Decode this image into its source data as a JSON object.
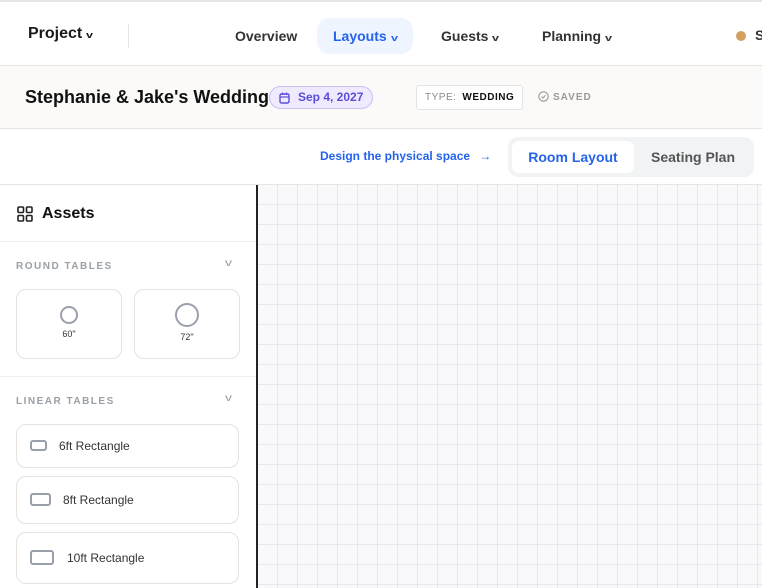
{
  "topnav": {
    "project": "Project",
    "items": [
      {
        "label": "Overview"
      },
      {
        "label": "Layouts",
        "active": true
      },
      {
        "label": "Guests"
      },
      {
        "label": "Planning"
      }
    ],
    "user_initial": "S",
    "status_color": "#d4a060"
  },
  "event": {
    "title": "Stephanie & Jake's Wedding",
    "date": "Sep 4, 2027",
    "type_key": "TYPE:",
    "type_value": "WEDDING",
    "status": "SAVED"
  },
  "subbar": {
    "hint": "Design the physical space",
    "tabs": [
      "Room Layout",
      "Seating Plan"
    ],
    "active_tab": "Room Layout"
  },
  "assets": {
    "title": "Assets",
    "round": {
      "label": "ROUND TABLES",
      "items": [
        "60\"",
        "72\""
      ]
    },
    "linear": {
      "label": "LINEAR TABLES",
      "items": [
        "6ft Rectangle",
        "8ft Rectangle",
        "10ft Rectangle"
      ]
    }
  },
  "colors": {
    "accent": "#2563eb",
    "date_badge": "#5b4ed6"
  }
}
